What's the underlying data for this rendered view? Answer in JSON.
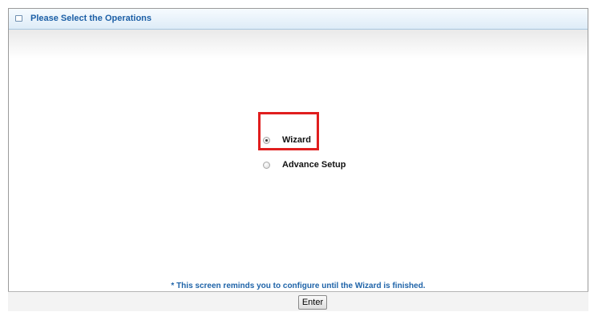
{
  "panel": {
    "title": "Please Select the Operations"
  },
  "options": [
    {
      "label": "Wizard",
      "checked": true
    },
    {
      "label": "Advance Setup",
      "checked": false
    }
  ],
  "note": "* This screen reminds you to configure until the Wizard is finished.",
  "enter_label": "Enter",
  "colors": {
    "title": "#1c5fa6",
    "highlight": "#e01e1e",
    "note": "#1e63a8"
  }
}
